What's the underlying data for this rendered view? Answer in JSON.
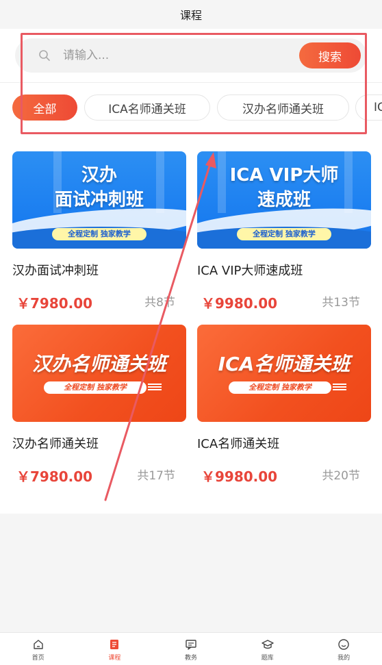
{
  "header": {
    "title": "课程"
  },
  "search": {
    "placeholder": "请输入...",
    "button_label": "搜索"
  },
  "tabs": [
    {
      "label": "全部",
      "active": true
    },
    {
      "label": "ICA名师通关班",
      "active": false
    },
    {
      "label": "汉办名师通关班",
      "active": false
    },
    {
      "label": "IC",
      "active": false
    }
  ],
  "courses": [
    {
      "banner_title_line1": "汉办",
      "banner_title_line2": "面试冲刺班",
      "banner_tagline": "全程定制 独家教学",
      "name": "汉办面试冲刺班",
      "price": "￥7980.00",
      "lessons": "共8节",
      "theme": "blue"
    },
    {
      "banner_title_line1": "ICA VIP大师",
      "banner_title_line2": "速成班",
      "banner_tagline": "全程定制 独家教学",
      "name": "ICA VIP大师速成班",
      "price": "￥9980.00",
      "lessons": "共13节",
      "theme": "blue"
    },
    {
      "banner_title_line1": "汉办名师通关班",
      "banner_tagline": "全程定制 独家教学",
      "name": "汉办名师通关班",
      "price": "￥7980.00",
      "lessons": "共17节",
      "theme": "orange"
    },
    {
      "banner_title_line1": "ICA名师通关班",
      "banner_tagline": "全程定制 独家教学",
      "name": "ICA名师通关班",
      "price": "￥9980.00",
      "lessons": "共20节",
      "theme": "orange"
    }
  ],
  "bottom_nav": [
    {
      "label": "首页",
      "icon": "home-icon",
      "active": false
    },
    {
      "label": "课程",
      "icon": "course-book-icon",
      "active": true
    },
    {
      "label": "教务",
      "icon": "chat-board-icon",
      "active": false
    },
    {
      "label": "题库",
      "icon": "graduation-cap-icon",
      "active": false
    },
    {
      "label": "我的",
      "icon": "smiley-profile-icon",
      "active": false
    }
  ],
  "colors": {
    "accent": "#ee4a35",
    "price": "#e8453a",
    "annotation": "#e95a62",
    "blue_banner": "#1a7df0",
    "orange_banner": "#f2501f"
  }
}
